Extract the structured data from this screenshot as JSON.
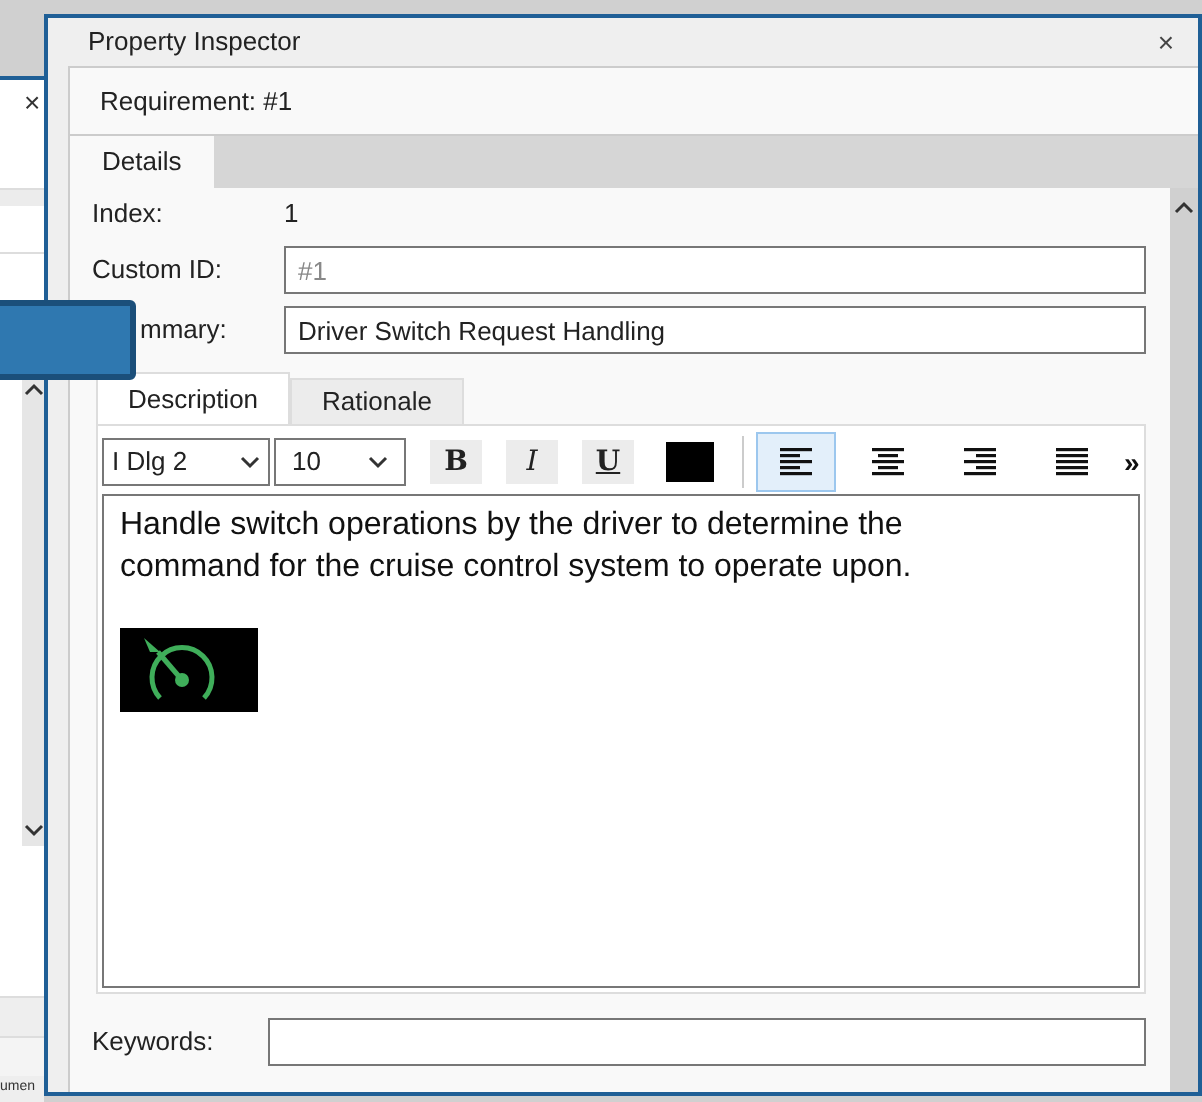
{
  "background_window": {
    "close": "×",
    "footer_text": "umen"
  },
  "inspector": {
    "title": "Property Inspector",
    "close": "×",
    "header": "Requirement: #1",
    "tabs": [
      {
        "label": "Details",
        "selected": true
      }
    ],
    "fields": [
      {
        "kind": "text",
        "label": "Index:",
        "value": "1",
        "covered": false
      },
      {
        "kind": "input",
        "label": "Custom ID:",
        "placeholder": "#1",
        "covered": false
      },
      {
        "kind": "input",
        "label": "mmary:",
        "value": "Driver Switch Request Handling",
        "covered": true
      }
    ],
    "editor_tabs": [
      {
        "label": "Description",
        "selected": true
      },
      {
        "label": "Rationale",
        "selected": false
      }
    ],
    "toolbar": {
      "style": "I Dlg 2",
      "size": "10",
      "format_buttons": [
        {
          "kind": "bold",
          "label": "B"
        },
        {
          "kind": "italic",
          "label": "I"
        },
        {
          "kind": "underline",
          "label": "U"
        }
      ],
      "align_buttons": [
        {
          "kind": "left",
          "selected": true
        },
        {
          "kind": "center",
          "selected": false
        },
        {
          "kind": "right",
          "selected": false
        },
        {
          "kind": "justify",
          "selected": false
        }
      ],
      "more": "»"
    },
    "description": "Handle switch operations by the driver to determine the command for the cruise control system to operate upon.",
    "keywords": {
      "label": "Keywords:"
    }
  }
}
